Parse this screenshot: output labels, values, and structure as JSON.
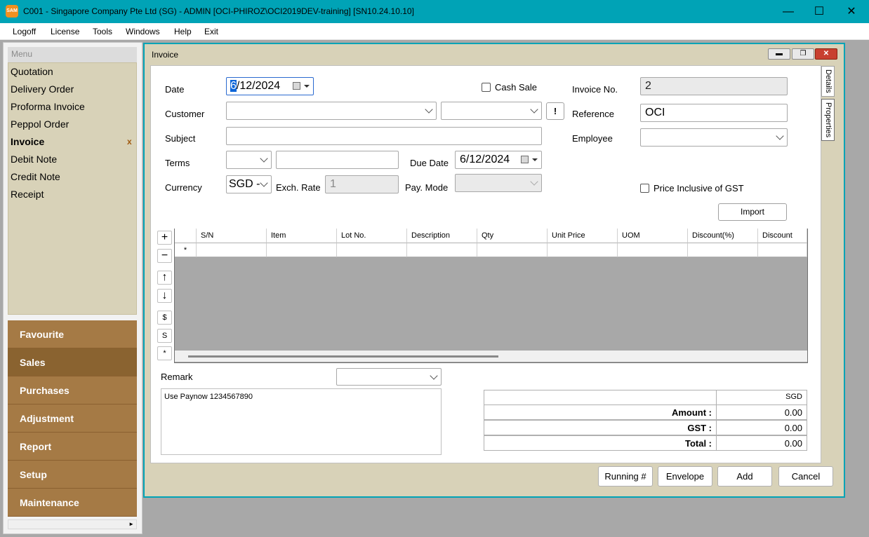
{
  "titlebar": {
    "app_icon": "SAM",
    "title": "C001 - Singapore Company Pte Ltd (SG) - ADMIN [OCI-PHIROZ\\OCI2019DEV-training] [SN10.24.10.10]",
    "minimize": "—",
    "maximize": "☐",
    "close": "✕"
  },
  "menubar": [
    "Logoff",
    "License",
    "Tools",
    "Windows",
    "Help",
    "Exit"
  ],
  "sidebar": {
    "header": "Menu",
    "items": [
      "Quotation",
      "Delivery Order",
      "Proforma Invoice",
      "Peppol Order",
      "Invoice",
      "Debit Note",
      "Credit Note",
      "Receipt"
    ],
    "active_item_marker": "x",
    "categories": [
      "Favourite",
      "Sales",
      "Purchases",
      "Adjustment",
      "Report",
      "Setup",
      "Maintenance"
    ]
  },
  "window": {
    "title": "Invoice",
    "tabs": [
      "Details",
      "Properties"
    ]
  },
  "form": {
    "date_label": "Date",
    "date_value_sel": "6",
    "date_value_rest": "/12/2024",
    "cash_sale_label": "Cash Sale",
    "invoice_no_label": "Invoice No.",
    "invoice_no_value": "2",
    "customer_label": "Customer",
    "customer_button": "!",
    "reference_label": "Reference",
    "reference_value": "OCI",
    "subject_label": "Subject",
    "employee_label": "Employee",
    "terms_label": "Terms",
    "due_date_label": "Due Date",
    "due_date_value": "6/12/2024",
    "currency_label": "Currency",
    "currency_value": "SGD -",
    "exch_rate_label": "Exch. Rate",
    "exch_rate_value": "1",
    "pay_mode_label": "Pay. Mode",
    "price_incl_gst_label": "Price Inclusive of GST",
    "import_button": "Import"
  },
  "grid": {
    "columns": [
      "S/N",
      "Item",
      "Lot No.",
      "Description",
      "Qty",
      "Unit Price",
      "UOM",
      "Discount(%)",
      "Discount"
    ],
    "new_row_marker": "*",
    "side_buttons": [
      "+",
      "−",
      "↑",
      "↓",
      "$",
      "S",
      "*"
    ]
  },
  "remark": {
    "label": "Remark",
    "text": "Use Paynow 1234567890"
  },
  "totals": {
    "currency": "SGD",
    "rows": [
      {
        "label": "Amount :",
        "value": "0.00"
      },
      {
        "label": "GST :",
        "value": "0.00"
      },
      {
        "label": "Total :",
        "value": "0.00"
      }
    ]
  },
  "footer_buttons": [
    "Running #",
    "Envelope",
    "Add",
    "Cancel"
  ],
  "colors": {
    "titlebar": "#00a3b6",
    "category_bg": "#a57a45",
    "category_active": "#8a6330",
    "panel_beige": "#d8d2b8",
    "selection": "#0a64d8"
  }
}
